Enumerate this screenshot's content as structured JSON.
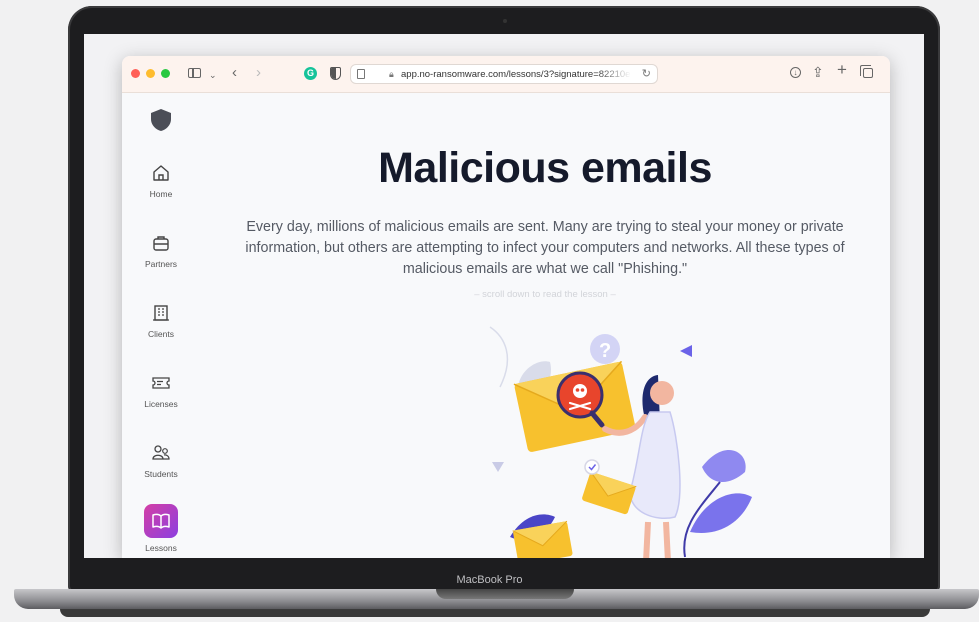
{
  "device": {
    "bezel_label": "MacBook Pro"
  },
  "browser": {
    "url": "app.no-ransomware.com/lessons/3?signature=82210e1a",
    "icons": [
      "sidebar-toggle-icon",
      "chevron-down-icon",
      "back-icon",
      "forward-icon",
      "grammarly-icon",
      "privacy-shield-icon",
      "reader-icon",
      "lock-icon",
      "reload-icon",
      "download-icon",
      "share-icon",
      "new-tab-icon",
      "tabs-overview-icon"
    ]
  },
  "sidebar": {
    "items": [
      {
        "label": "Home",
        "icon": "home-icon"
      },
      {
        "label": "Partners",
        "icon": "briefcase-icon"
      },
      {
        "label": "Clients",
        "icon": "building-icon"
      },
      {
        "label": "Licenses",
        "icon": "ticket-icon"
      },
      {
        "label": "Students",
        "icon": "users-icon"
      },
      {
        "label": "Lessons",
        "icon": "book-icon",
        "active": true
      }
    ]
  },
  "lesson": {
    "title": "Malicious emails",
    "intro": "Every day, millions of malicious emails are sent. Many are trying to steal your money or private information, but others are attempting to infect your computers and networks. All these types of malicious emails are what we call \"Phishing.\"",
    "scroll_hint": "– scroll down to read the lesson –",
    "question_mark": "?"
  },
  "colors": {
    "accent_gradient_start": "#d43fa5",
    "accent_gradient_end": "#8c3fe0",
    "title": "#151a2b",
    "envelope": "#f7c12e",
    "danger": "#e8452c",
    "purple": "#6b63e8"
  }
}
